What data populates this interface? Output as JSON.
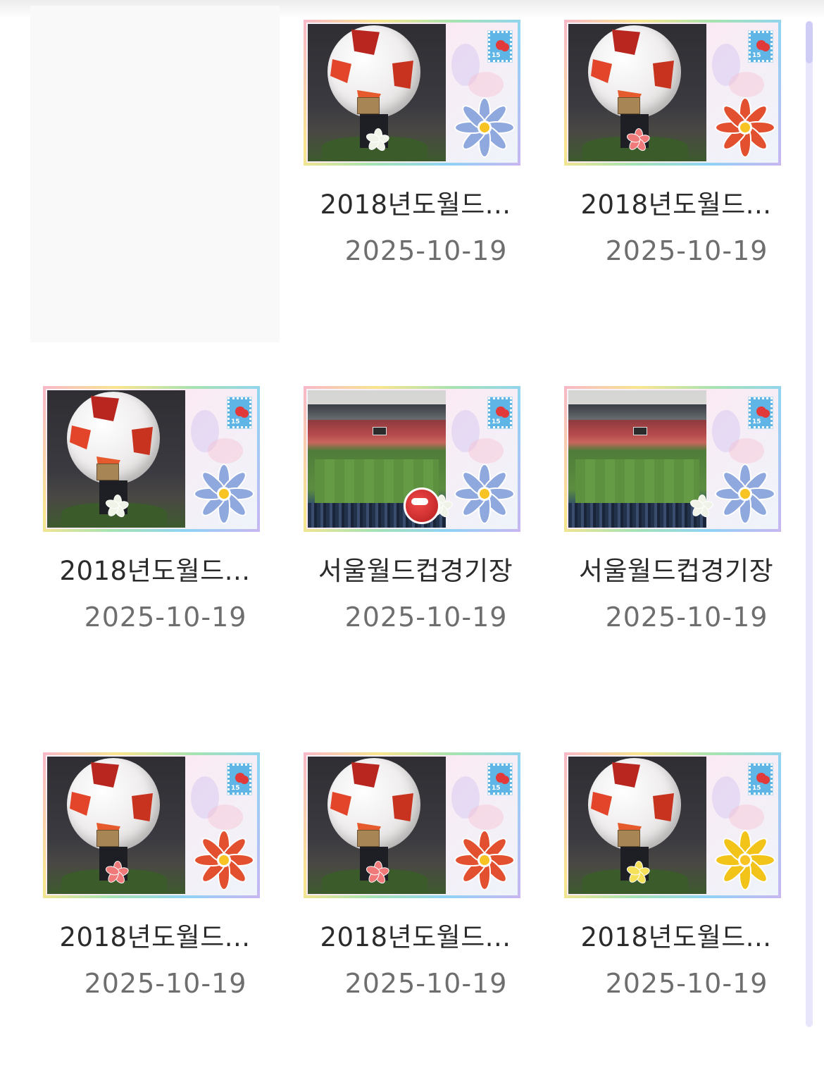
{
  "gallery": {
    "items": [
      {
        "title": "2018년도월드...",
        "date": "2025-10-19",
        "photo": "ball",
        "flower_color": "#8fa8dd",
        "small_flower": "#f0f4e8"
      },
      {
        "title": "2018년도월드...",
        "date": "2025-10-19",
        "photo": "ball",
        "flower_color": "#e2502f",
        "small_flower": "#f07a7a"
      },
      {
        "title": "2018년도월드...",
        "date": "2025-10-19",
        "photo": "ball",
        "flower_color": "#8fa8dd",
        "small_flower": "#f0f4e8"
      },
      {
        "title": "서울월드컵경기장",
        "date": "2025-10-19",
        "photo": "stadium",
        "flower_color": "#8fa8dd",
        "small_flower": "#f0f4e8"
      },
      {
        "title": "서울월드컵경기장",
        "date": "2025-10-19",
        "photo": "stadium",
        "flower_color": "#8fa8dd",
        "small_flower": "#f0f4e8"
      },
      {
        "title": "2018년도월드...",
        "date": "2025-10-19",
        "photo": "ball",
        "flower_color": "#e2502f",
        "small_flower": "#f07a7a"
      },
      {
        "title": "2018년도월드...",
        "date": "2025-10-19",
        "photo": "ball",
        "flower_color": "#e2502f",
        "small_flower": "#f07a7a"
      },
      {
        "title": "2018년도월드...",
        "date": "2025-10-19",
        "photo": "ball",
        "flower_color": "#f2c318",
        "small_flower": "#f5e05a"
      }
    ]
  },
  "colors": {
    "title_text": "#2b2b2b",
    "date_text": "#6e6e6e",
    "scrollbar_track": "#e7e6fb",
    "scrollbar_thumb": "#cfcdf6"
  }
}
